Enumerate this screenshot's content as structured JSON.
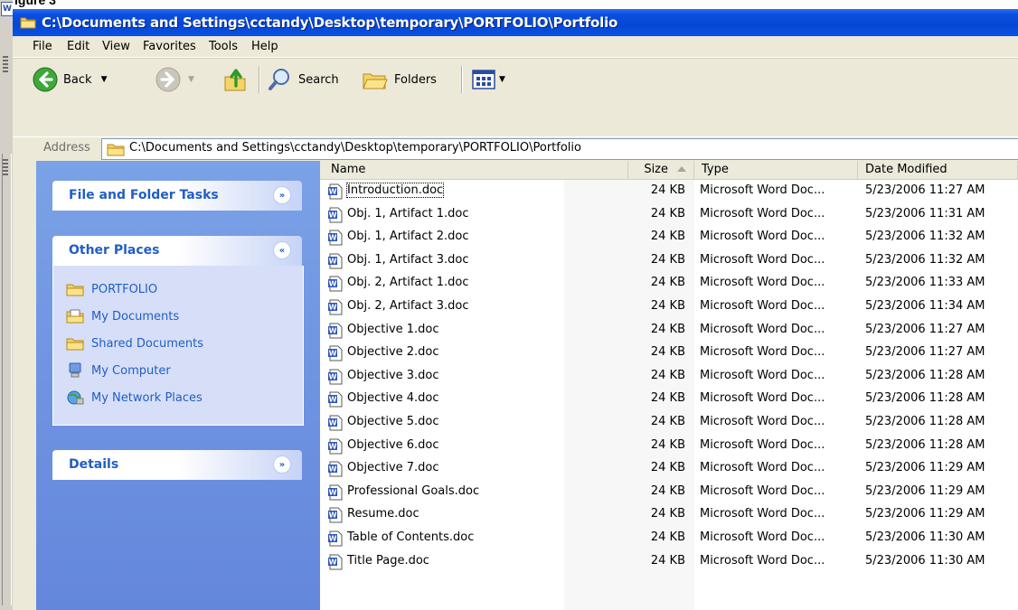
{
  "top_caption": "igure 3",
  "window": {
    "title": "C:\\Documents and Settings\\cctandy\\Desktop\\temporary\\PORTFOLIO\\Portfolio"
  },
  "menu": {
    "file": "File",
    "edit": "Edit",
    "view": "View",
    "favorites": "Favorites",
    "tools": "Tools",
    "help": "Help"
  },
  "toolbar": {
    "back": "Back",
    "search": "Search",
    "folders": "Folders"
  },
  "address": {
    "label": "Address",
    "value": "C:\\Documents and Settings\\cctandy\\Desktop\\temporary\\PORTFOLIO\\Portfolio"
  },
  "task_pane": {
    "file_folder_tasks": "File and Folder Tasks",
    "other_places": {
      "title": "Other Places",
      "items": [
        {
          "label": "PORTFOLIO",
          "icon": "folder-icon"
        },
        {
          "label": "My Documents",
          "icon": "my-documents-icon"
        },
        {
          "label": "Shared Documents",
          "icon": "folder-icon"
        },
        {
          "label": "My Computer",
          "icon": "my-computer-icon"
        },
        {
          "label": "My Network Places",
          "icon": "network-places-icon"
        }
      ]
    },
    "details": "Details"
  },
  "columns": {
    "name": "Name",
    "size": "Size",
    "type": "Type",
    "date": "Date Modified"
  },
  "files": [
    {
      "name": "Introduction.doc",
      "size": "24 KB",
      "type": "Microsoft Word Doc...",
      "date": "5/23/2006 11:27 AM"
    },
    {
      "name": "Obj. 1, Artifact 1.doc",
      "size": "24 KB",
      "type": "Microsoft Word Doc...",
      "date": "5/23/2006 11:31 AM"
    },
    {
      "name": "Obj. 1, Artifact 2.doc",
      "size": "24 KB",
      "type": "Microsoft Word Doc...",
      "date": "5/23/2006 11:32 AM"
    },
    {
      "name": "Obj. 1, Artifact 3.doc",
      "size": "24 KB",
      "type": "Microsoft Word Doc...",
      "date": "5/23/2006 11:32 AM"
    },
    {
      "name": "Obj. 2, Artifact 1.doc",
      "size": "24 KB",
      "type": "Microsoft Word Doc...",
      "date": "5/23/2006 11:33 AM"
    },
    {
      "name": "Obj. 2, Artifact 3.doc",
      "size": "24 KB",
      "type": "Microsoft Word Doc...",
      "date": "5/23/2006 11:34 AM"
    },
    {
      "name": "Objective 1.doc",
      "size": "24 KB",
      "type": "Microsoft Word Doc...",
      "date": "5/23/2006 11:27 AM"
    },
    {
      "name": "Objective 2.doc",
      "size": "24 KB",
      "type": "Microsoft Word Doc...",
      "date": "5/23/2006 11:27 AM"
    },
    {
      "name": "Objective 3.doc",
      "size": "24 KB",
      "type": "Microsoft Word Doc...",
      "date": "5/23/2006 11:28 AM"
    },
    {
      "name": "Objective 4.doc",
      "size": "24 KB",
      "type": "Microsoft Word Doc...",
      "date": "5/23/2006 11:28 AM"
    },
    {
      "name": "Objective 5.doc",
      "size": "24 KB",
      "type": "Microsoft Word Doc...",
      "date": "5/23/2006 11:28 AM"
    },
    {
      "name": "Objective 6.doc",
      "size": "24 KB",
      "type": "Microsoft Word Doc...",
      "date": "5/23/2006 11:28 AM"
    },
    {
      "name": "Objective 7.doc",
      "size": "24 KB",
      "type": "Microsoft Word Doc...",
      "date": "5/23/2006 11:29 AM"
    },
    {
      "name": "Professional Goals.doc",
      "size": "24 KB",
      "type": "Microsoft Word Doc...",
      "date": "5/23/2006 11:29 AM"
    },
    {
      "name": "Resume.doc",
      "size": "24 KB",
      "type": "Microsoft Word Doc...",
      "date": "5/23/2006 11:29 AM"
    },
    {
      "name": "Table of Contents.doc",
      "size": "24 KB",
      "type": "Microsoft Word Doc...",
      "date": "5/23/2006 11:30 AM"
    },
    {
      "name": "Title Page.doc",
      "size": "24 KB",
      "type": "Microsoft Word Doc...",
      "date": "5/23/2006 11:30 AM"
    }
  ],
  "colors": {
    "titlebar": "#0646d4",
    "task_pane": "#6c8fe0",
    "task_link": "#215dc6"
  }
}
